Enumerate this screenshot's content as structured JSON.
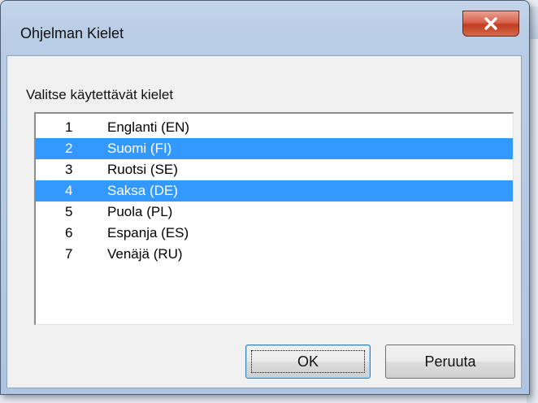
{
  "dialog": {
    "title": "Ohjelman Kielet",
    "list_label": "Valitse käytettävät kielet",
    "languages": [
      {
        "num": "1",
        "name": "Englanti (EN)",
        "selected": false
      },
      {
        "num": "2",
        "name": "Suomi (FI)",
        "selected": true
      },
      {
        "num": "3",
        "name": "Ruotsi (SE)",
        "selected": false
      },
      {
        "num": "4",
        "name": "Saksa (DE)",
        "selected": true
      },
      {
        "num": "5",
        "name": "Puola (PL)",
        "selected": false
      },
      {
        "num": "6",
        "name": "Espanja (ES)",
        "selected": false
      },
      {
        "num": "7",
        "name": "Venäjä (RU)",
        "selected": false
      }
    ],
    "ok_label": "OK",
    "cancel_label": "Peruuta",
    "close_icon": "close-icon"
  },
  "colors": {
    "selection": "#3399ff",
    "close_button": "#c9452b"
  }
}
